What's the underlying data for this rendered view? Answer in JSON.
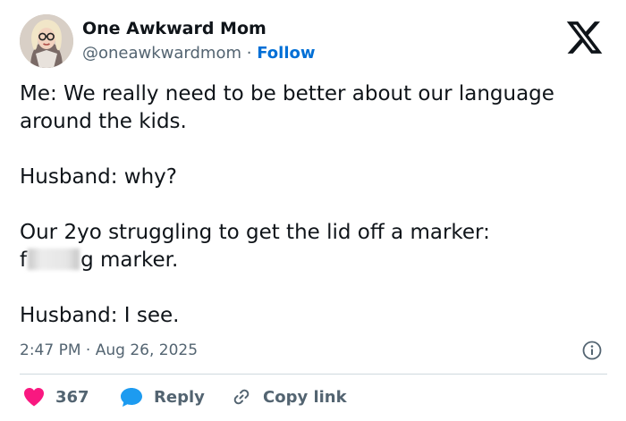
{
  "author": {
    "display_name": "One Awkward Mom",
    "handle": "@oneawkwardmom",
    "separator": "·",
    "follow_label": "Follow"
  },
  "tweet": {
    "paragraphs": [
      "Me: We really need to be better about our language around the kids.",
      "Husband: why?",
      "Our 2yo struggling to get the lid off a marker:",
      "Husband: I see."
    ],
    "censored_line": {
      "prefix": "f",
      "suffix": "g marker."
    },
    "time": "2:47 PM",
    "date": "Aug 26, 2025",
    "time_separator": "·"
  },
  "actions": {
    "like_count": "367",
    "reply_label": "Reply",
    "copy_link_label": "Copy link"
  },
  "colors": {
    "like": "#f91880",
    "reply": "#1d9bf0",
    "link": "#006fd6",
    "muted": "#536471"
  },
  "icons": [
    "x-logo-icon",
    "info-icon",
    "heart-icon",
    "reply-bubble-icon",
    "link-icon"
  ]
}
